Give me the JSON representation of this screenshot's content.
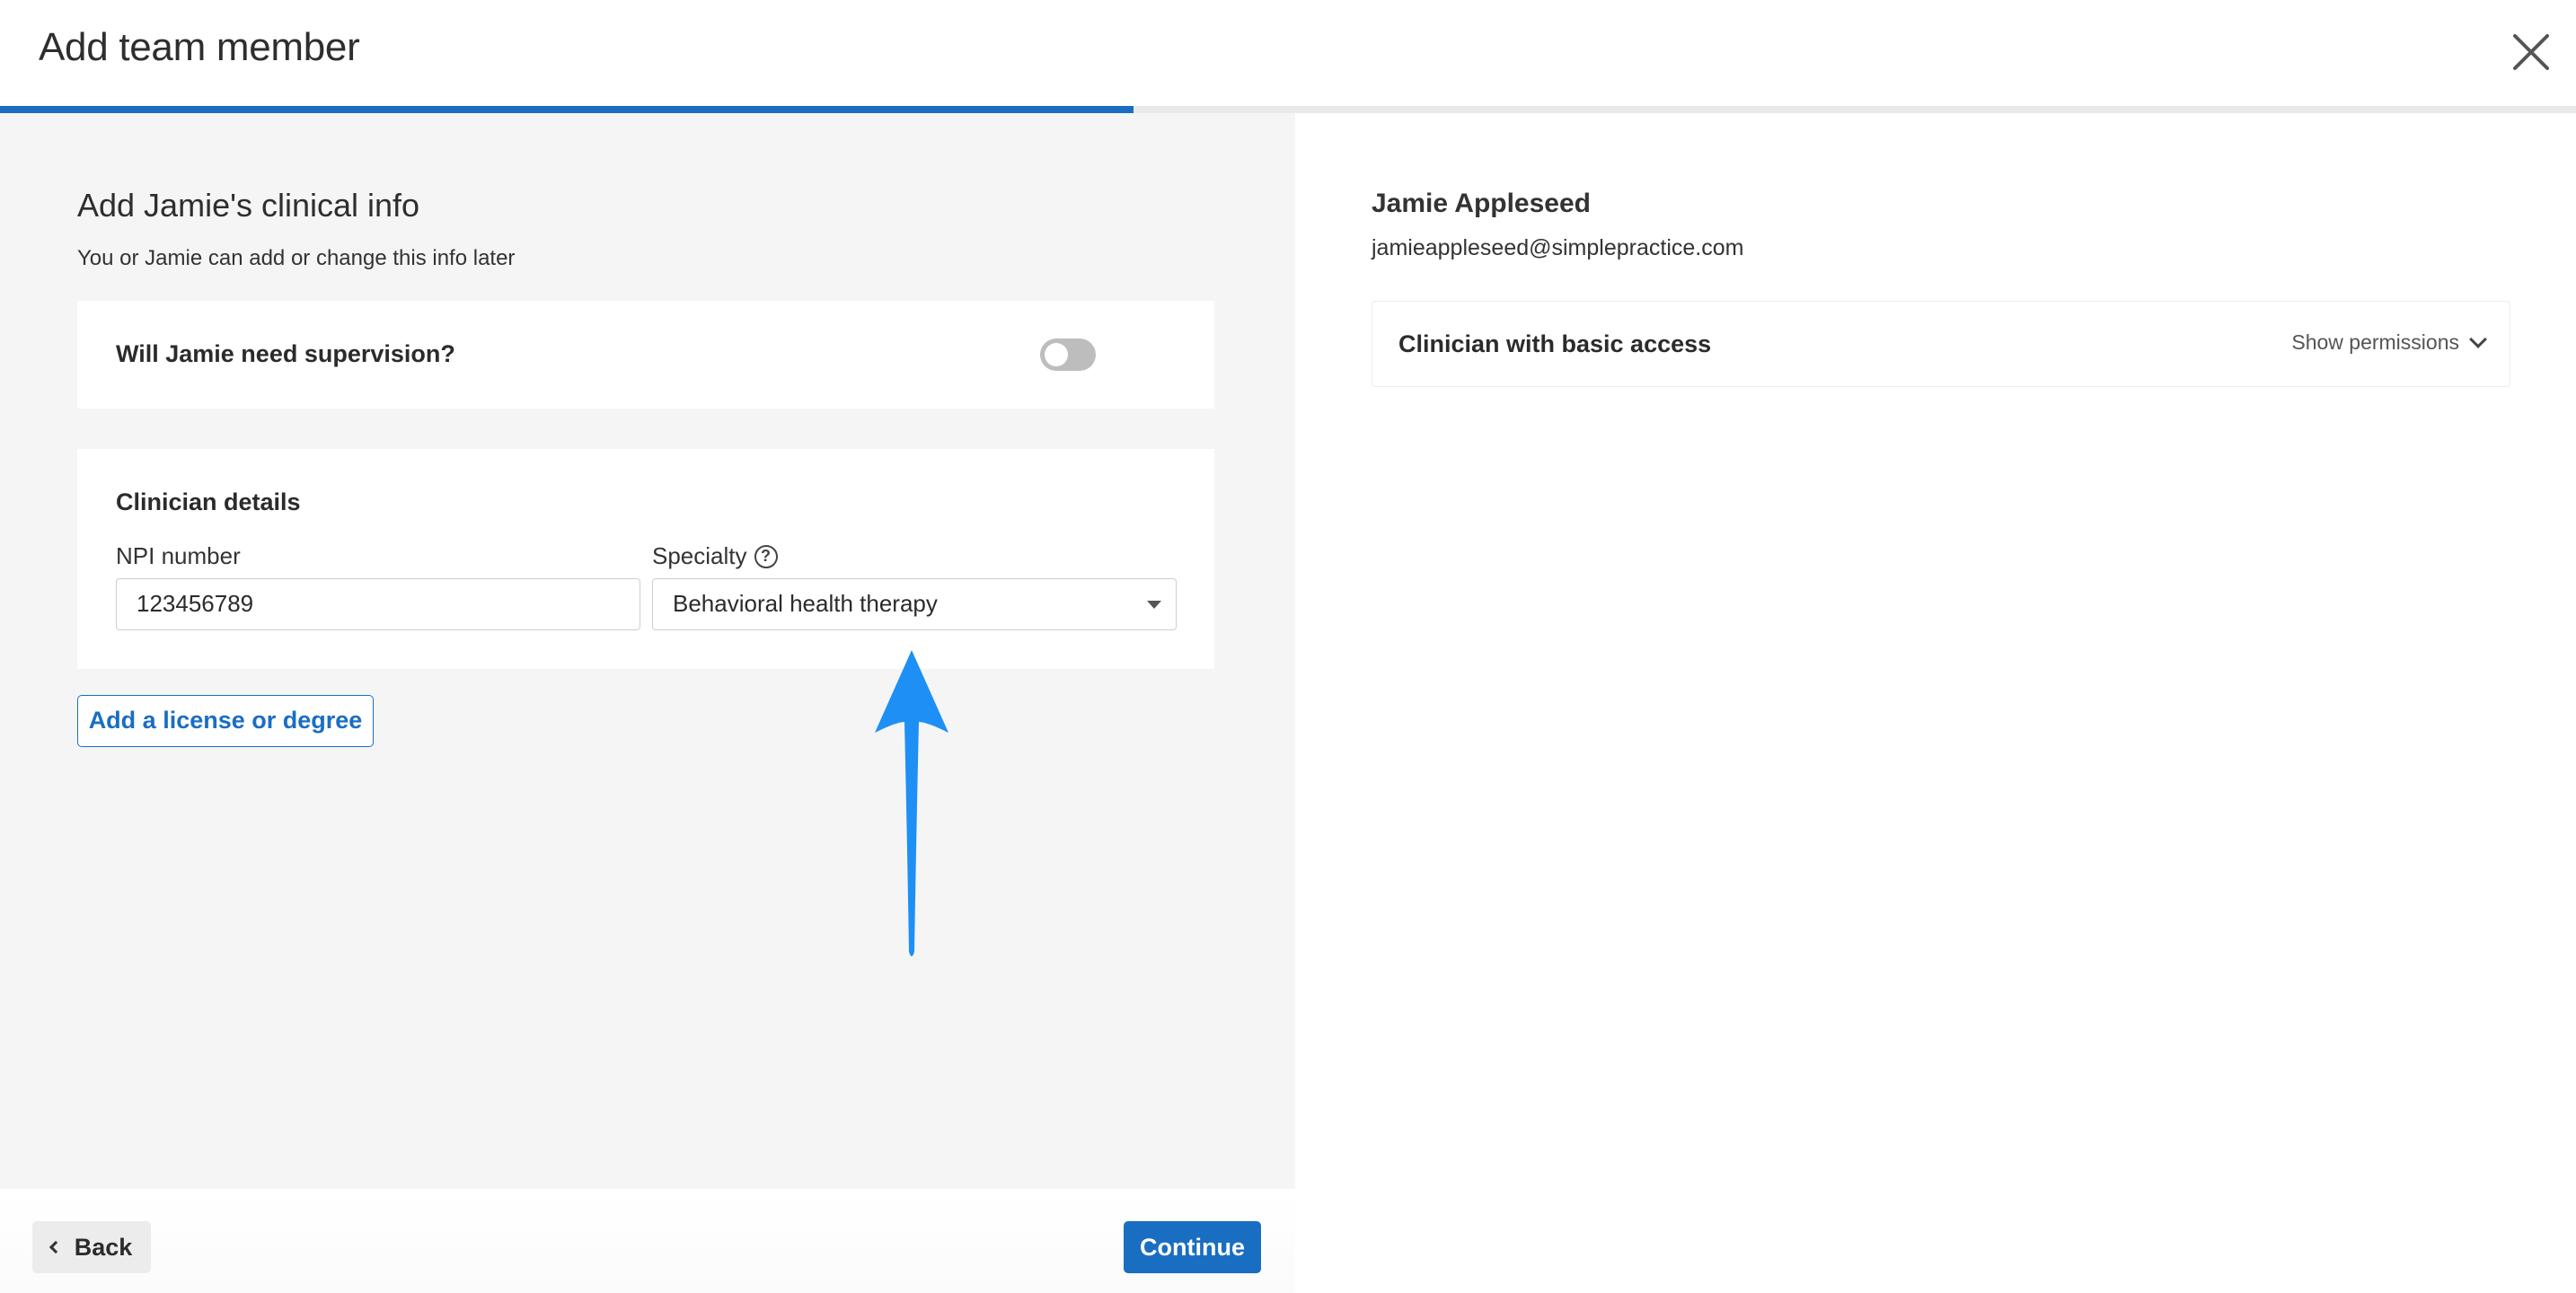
{
  "header": {
    "title": "Add team member",
    "progress_fraction": 0.44,
    "accent_color": "#1a6ec2"
  },
  "clinical": {
    "title": "Add Jamie's clinical info",
    "subtitle": "You or Jamie can add or change this info later",
    "supervision": {
      "label": "Will Jamie need supervision?",
      "enabled": false
    },
    "details": {
      "title": "Clinician details",
      "npi_label": "NPI number",
      "npi_value": "123456789",
      "specialty_label": "Specialty",
      "specialty_value": "Behavioral health therapy",
      "help_icon": "question-circle-icon"
    },
    "add_license_label": "Add a license or degree"
  },
  "footer": {
    "back_label": "Back",
    "continue_label": "Continue"
  },
  "member": {
    "name": "Jamie Appleseed",
    "email": "jamieappleseed@simplepractice.com",
    "role": "Clinician with basic access",
    "show_permissions_label": "Show permissions"
  },
  "annotation": {
    "arrow_color": "#1e8ff5"
  }
}
